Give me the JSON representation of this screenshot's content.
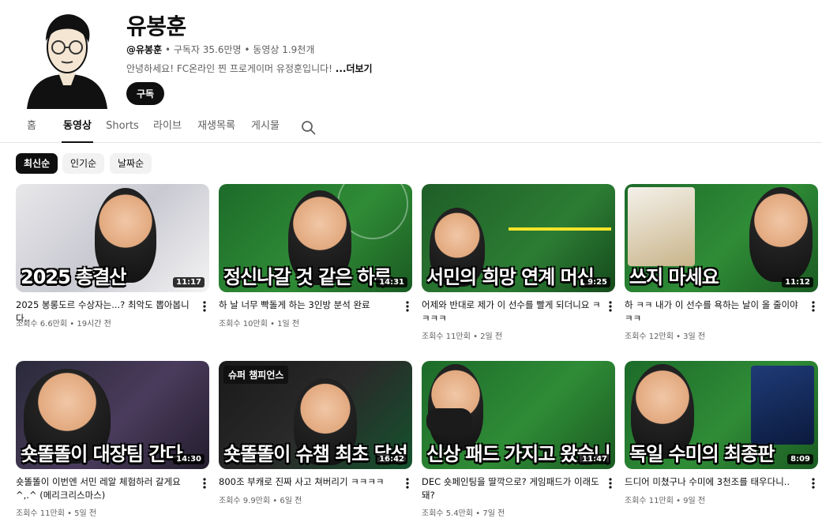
{
  "channel": {
    "name": "유봉훈",
    "handle": "@유봉훈",
    "stats": " • 구독자 35.6만명 • 동영상 1.9천개",
    "description": "안녕하세요! FC온라인 찐 프로게이머 유정훈입니다! ",
    "more_label": "...더보기",
    "subscribe_label": "구독"
  },
  "tabs": [
    {
      "label": "홈",
      "active": false
    },
    {
      "label": "동영상",
      "active": true
    },
    {
      "label": "Shorts",
      "active": false
    },
    {
      "label": "라이브",
      "active": false
    },
    {
      "label": "재생목록",
      "active": false
    },
    {
      "label": "게시물",
      "active": false
    }
  ],
  "search_icon": "search-icon",
  "chips": [
    {
      "label": "최신순",
      "active": true
    },
    {
      "label": "인기순",
      "active": false
    },
    {
      "label": "날짜순",
      "active": false
    }
  ],
  "videos": [
    {
      "caption": "2025 총결산",
      "badge": "",
      "duration": "11:17",
      "title": "2025 봉롱도르 수상자는...? 최악도 뽑아봅니다..",
      "views": "조회수 6.6만회",
      "age": "19시간 전"
    },
    {
      "caption": "정신나갈 것 같은 하루",
      "badge": "",
      "duration": "14:31",
      "title": "하 날 너무 빡돌게 하는 3인방 분석 완료",
      "views": "조회수 10만회",
      "age": "1일 전"
    },
    {
      "caption": "서민의 희망 연계 머신",
      "badge": "",
      "duration": "9:25",
      "title": "어제와 반대로 제가 이 선수를 빨게 되더니요 ㅋㅋㅋㅋ",
      "views": "조회수 11만회",
      "age": "2일 전"
    },
    {
      "caption": "쓰지 마세요",
      "badge": "",
      "duration": "11:12",
      "title": "하 ㅋㅋ 내가 이 선수를 욕하는 날이 올 줄이야 ㅋㅋ",
      "views": "조회수 12만회",
      "age": "3일 전"
    },
    {
      "caption": "숏똘똘이 대장팀 간다",
      "badge": "",
      "duration": "14:30",
      "title": "숏똘똘이 이번엔 서민 레알 체험하러 갈게요 ^,.^ (메리크리스마스)",
      "views": "조회수 11만회",
      "age": "5일 전"
    },
    {
      "caption": "숏똘똘이 슈챔 최초 달성",
      "badge": "슈퍼 챔피언스",
      "duration": "16:42",
      "title": "800조 부캐로 진짜 사고 쳐버리기 ㅋㅋㅋㅋ",
      "views": "조회수 9.9만회",
      "age": "6일 전"
    },
    {
      "caption": "신상 패드 가지고 왔습니다",
      "badge": "",
      "duration": "11:47",
      "title": "DEC 숏페인팅을 딸깍으로? 게임패드가 이래도 돼?",
      "views": "조회수 5.4만회",
      "age": "7일 전"
    },
    {
      "caption": "독일 수미의 최종판",
      "badge": "",
      "duration": "8:09",
      "title": "드디어 미쳤구나 수미에 3천조를 태우다니..",
      "views": "조회수 11만회",
      "age": "9일 전"
    }
  ]
}
